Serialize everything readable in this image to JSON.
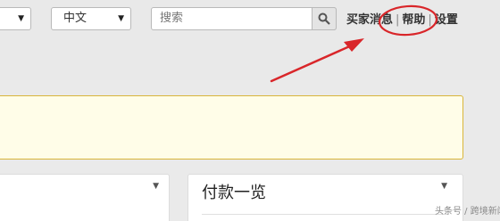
{
  "top_bar": {
    "language_select": {
      "value": "中文"
    },
    "search": {
      "placeholder": "搜索",
      "button_icon": "search-icon"
    },
    "nav": {
      "buyer_messages": "买家消息",
      "help": "帮助",
      "settings": "设置",
      "separator": "|"
    }
  },
  "panels": {
    "payment_overview": {
      "title": "付款一览"
    }
  },
  "annotation": {
    "highlight_color": "#d9262a",
    "target": "帮助"
  },
  "watermark": "头条号 / 跨境新闻局",
  "colors": {
    "notice_border": "#d9b53a",
    "notice_background": "#fffde8"
  }
}
